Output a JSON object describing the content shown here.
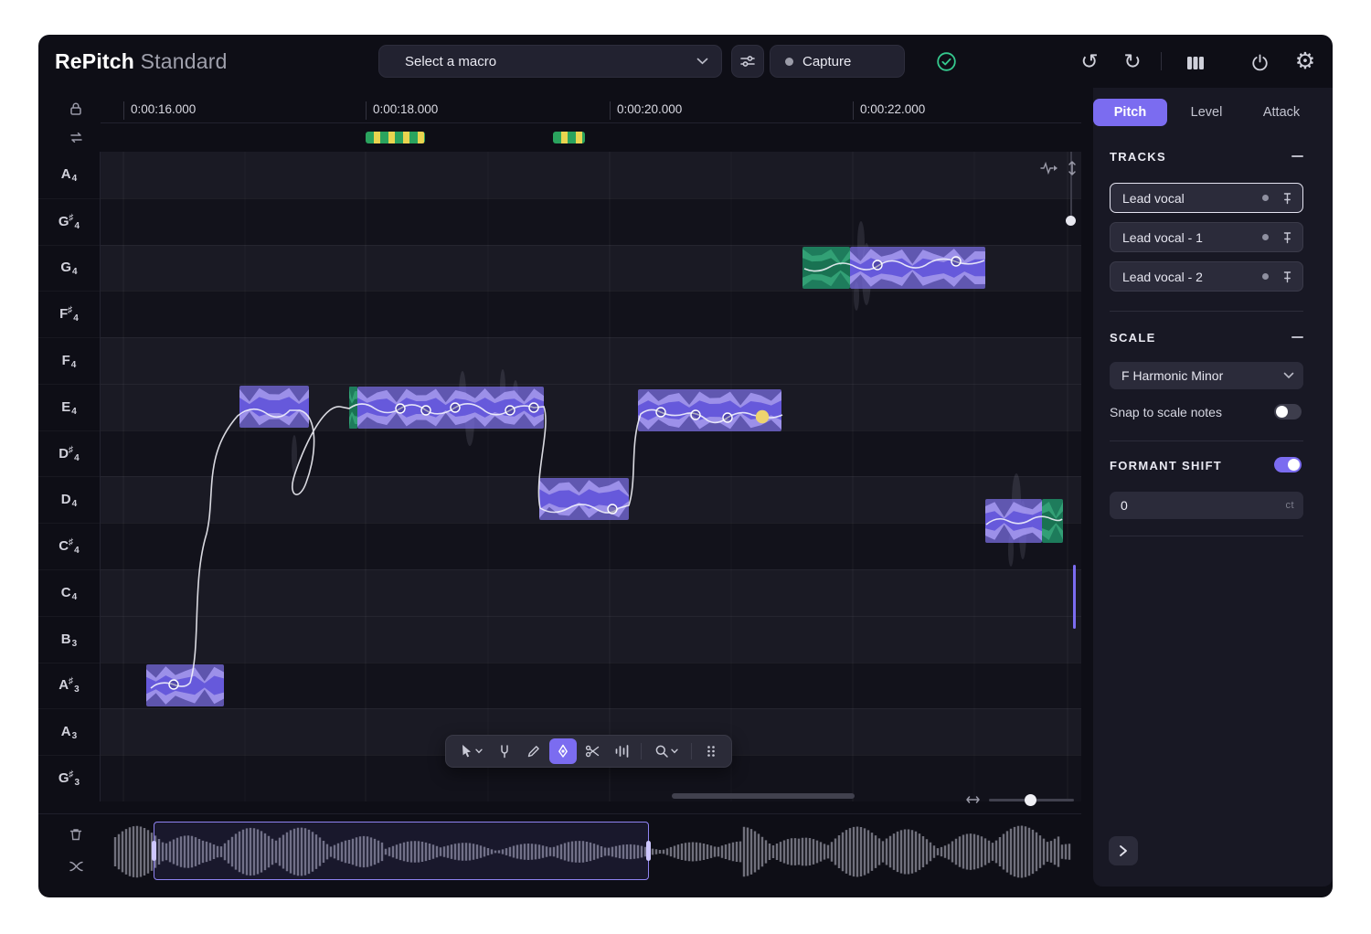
{
  "header": {
    "brand_bold": "RePitch",
    "brand_light": "Standard",
    "macro_select": "Select a macro",
    "capture": "Capture"
  },
  "ruler": {
    "ticks": [
      "0:00:16.000",
      "0:00:18.000",
      "0:00:20.000",
      "0:00:22.000"
    ]
  },
  "piano": {
    "notes": [
      {
        "letter": "A",
        "acc": "",
        "oct": "4"
      },
      {
        "letter": "G",
        "acc": "♯",
        "oct": "4"
      },
      {
        "letter": "G",
        "acc": "",
        "oct": "4"
      },
      {
        "letter": "F",
        "acc": "♯",
        "oct": "4"
      },
      {
        "letter": "F",
        "acc": "",
        "oct": "4"
      },
      {
        "letter": "E",
        "acc": "",
        "oct": "4"
      },
      {
        "letter": "D",
        "acc": "♯",
        "oct": "4"
      },
      {
        "letter": "D",
        "acc": "",
        "oct": "4"
      },
      {
        "letter": "C",
        "acc": "♯",
        "oct": "4"
      },
      {
        "letter": "C",
        "acc": "",
        "oct": "4"
      },
      {
        "letter": "B",
        "acc": "",
        "oct": "3"
      },
      {
        "letter": "A",
        "acc": "♯",
        "oct": "3"
      },
      {
        "letter": "A",
        "acc": "",
        "oct": "3"
      },
      {
        "letter": "G",
        "acc": "♯",
        "oct": "3"
      }
    ]
  },
  "panel": {
    "tabs": {
      "pitch": "Pitch",
      "level": "Level",
      "attack": "Attack"
    },
    "tracks": {
      "title": "TRACKS",
      "items": [
        {
          "name": "Lead vocal"
        },
        {
          "name": "Lead vocal - 1"
        },
        {
          "name": "Lead vocal - 2"
        }
      ]
    },
    "scale": {
      "title": "SCALE",
      "value": "F Harmonic Minor",
      "snap_label": "Snap to scale notes"
    },
    "formant": {
      "title": "FORMANT SHIFT",
      "value": "0",
      "unit": "ct"
    }
  },
  "colors": {
    "accent": "#7b6cf0",
    "note_purple": "#7c6fe6",
    "note_green": "#1f8a64",
    "check_green": "#35c98e",
    "active_node_yellow": "#edd36f"
  }
}
